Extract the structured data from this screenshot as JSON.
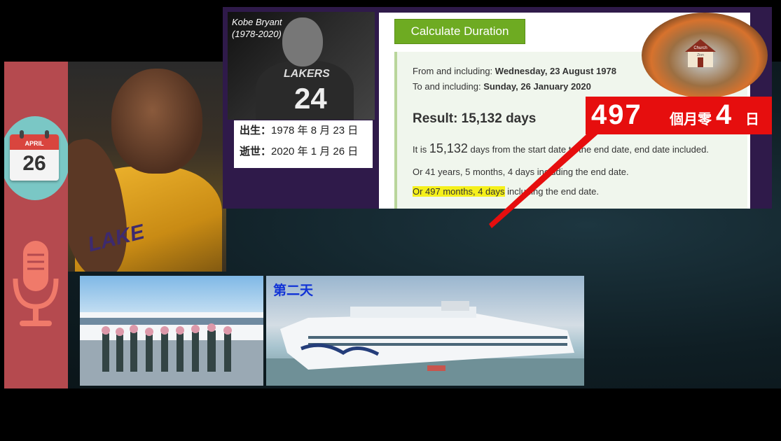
{
  "sidebar": {
    "calendar": {
      "month": "APRIL",
      "day": "26"
    }
  },
  "kobe_card": {
    "name": "Kobe Bryant",
    "years": "(1978-2020)",
    "jersey_number": "24",
    "jersey_text": "LAKERS",
    "born_label": "出生：",
    "born_date": "1978 年 8 月 23 日",
    "died_label": "逝世：",
    "died_date": "2020 年 1 月 26 日"
  },
  "photo_text": "LAKE",
  "calculator": {
    "button_label": "Calculate Duration",
    "from_label": "From and including: ",
    "from_value": "Wednesday, 23 August 1978",
    "to_label": "To and including: ",
    "to_value": "Sunday, 26 January 2020",
    "result": "Result: 15,132 days",
    "line1_pre": "It is ",
    "line1_num": "15,132",
    "line1_post": " days from the start date to the end date, end date included.",
    "line2": "Or 41 years, 5 months, 4 days including the end date.",
    "line3_highlight": "Or 497 months, 4 days",
    "line3_rest": " including the end date."
  },
  "church_logo": {
    "line1": "Church",
    "line2": "Zion"
  },
  "banner": {
    "num1": "497",
    "text1": "個月零",
    "num2": "4",
    "text2": "日"
  },
  "ship_caption": "第二天",
  "colors": {
    "sidebar": "#b54a4f",
    "banner": "#e60e0e",
    "button": "#6eab22",
    "highlight": "#f5f01a",
    "caption": "#1133d6"
  }
}
